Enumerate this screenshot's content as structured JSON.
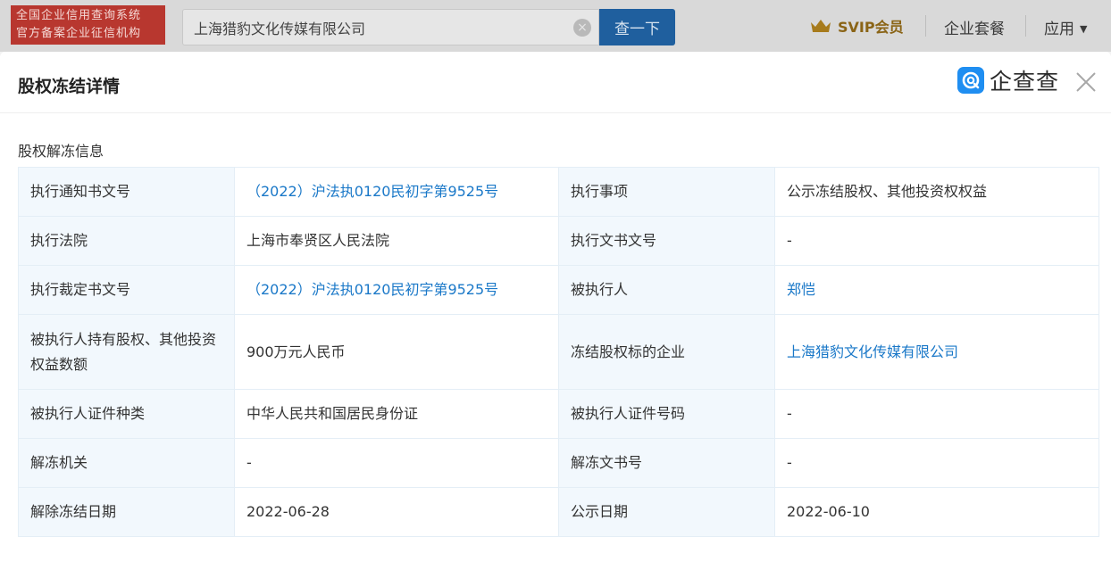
{
  "topbar": {
    "logo_line1": "全国企业信用查询系统",
    "logo_line2": "官方备案企业征信机构",
    "search_value": "上海猎豹文化传媒有限公司",
    "search_button": "查一下",
    "svip_label": "SVIP会员",
    "nav_package": "企业套餐",
    "nav_apps": "应用"
  },
  "dialog": {
    "title": "股权冻结详情",
    "brand": "企查查",
    "section_label": "股权解冻信息"
  },
  "rows": [
    {
      "k1": "执行通知书文号",
      "v1": "（2022）沪法执0120民初字第9525号",
      "k2": "执行事项",
      "v2": "公示冻结股权、其他投资权权益"
    },
    {
      "k1": "执行法院",
      "v1": "上海市奉贤区人民法院",
      "k2": "执行文书文号",
      "v2": "-"
    },
    {
      "k1": "执行裁定书文号",
      "v1": "（2022）沪法执0120民初字第9525号",
      "k2": "被执行人",
      "v2": "郑恺"
    },
    {
      "k1": "被执行人持有股权、其他投资权益数额",
      "v1": "900万元人民币",
      "k2": "冻结股权标的企业",
      "v2": "上海猎豹文化传媒有限公司"
    },
    {
      "k1": "被执行人证件种类",
      "v1": "中华人民共和国居民身份证",
      "k2": "被执行人证件号码",
      "v2": "-"
    },
    {
      "k1": "解冻机关",
      "v1": "-",
      "k2": "解冻文书号",
      "v2": "-"
    },
    {
      "k1": "解除冻结日期",
      "v1": "2022-06-28",
      "k2": "公示日期",
      "v2": "2022-06-10"
    }
  ],
  "colors": {
    "link": "#1a78c8",
    "key_cell_bg": "#f2f8fd",
    "search_button_bg": "#1f5f9e",
    "logo_bg": "#b8372f",
    "brand_icon_bg": "#1f8ef1"
  },
  "icons": [
    "clear-icon",
    "crown-icon",
    "caret-down-icon",
    "brand-logo-icon",
    "close-icon"
  ]
}
